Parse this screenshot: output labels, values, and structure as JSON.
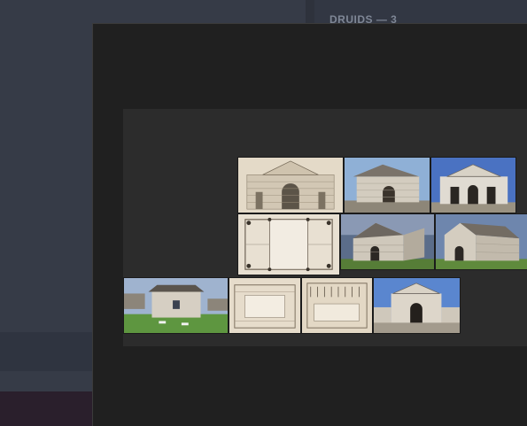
{
  "right_panel": {
    "section_title": "DRUIDS — 3"
  },
  "gallery": {
    "items": [
      {
        "name": "engraving-facade-thumbnail",
        "kind": "engraving"
      },
      {
        "name": "photo-pavilion-front-angle-thumbnail",
        "kind": "photo"
      },
      {
        "name": "photo-pavilion-front-thumbnail",
        "kind": "photo"
      },
      {
        "name": "floor-plan-thumbnail",
        "kind": "plan"
      },
      {
        "name": "photo-pavilion-corner-thumbnail",
        "kind": "photo"
      },
      {
        "name": "photo-pavilion-side-thumbnail",
        "kind": "photo"
      },
      {
        "name": "photo-pavilion-rear-lawn-thumbnail",
        "kind": "photo"
      },
      {
        "name": "engraving-section-a-thumbnail",
        "kind": "engraving"
      },
      {
        "name": "engraving-section-b-thumbnail",
        "kind": "engraving"
      },
      {
        "name": "photo-pavilion-gate-thumbnail",
        "kind": "photo"
      }
    ]
  },
  "colors": {
    "app_background": "#333844",
    "overlay_background": "#202020",
    "gallery_background": "#2c2c2c",
    "sky": "#7d98c4",
    "stone": "#c9c3b7",
    "roof": "#6d6760",
    "grass": "#5c8a3a",
    "paper": "#e4dac8"
  }
}
